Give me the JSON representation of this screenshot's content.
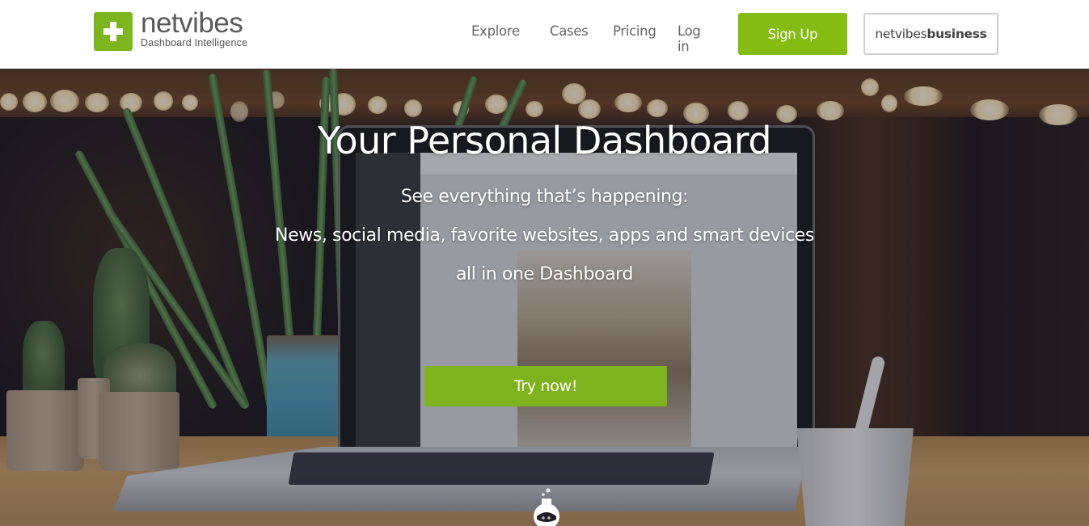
{
  "brand": {
    "name": "netvibes",
    "tagline": "Dashboard Intelligence",
    "accent_color": "#85bc11",
    "logo_icon": "plus-icon"
  },
  "nav": {
    "items": [
      {
        "label": "Explore"
      },
      {
        "label": "Cases"
      },
      {
        "label": "Pricing"
      },
      {
        "label": "Log in"
      }
    ],
    "signup_label": "Sign Up",
    "business_label_regular": "netvibes",
    "business_label_bold": "business"
  },
  "hero": {
    "title": "Your Personal Dashboard",
    "lines": [
      "See everything that’s happening:",
      "News, social media, favorite websites, apps and smart devices",
      "all in one Dashboard"
    ],
    "cta_label": "Try now!",
    "bottom_icon": "flask-icon",
    "cta_color": "#7fb31d"
  }
}
